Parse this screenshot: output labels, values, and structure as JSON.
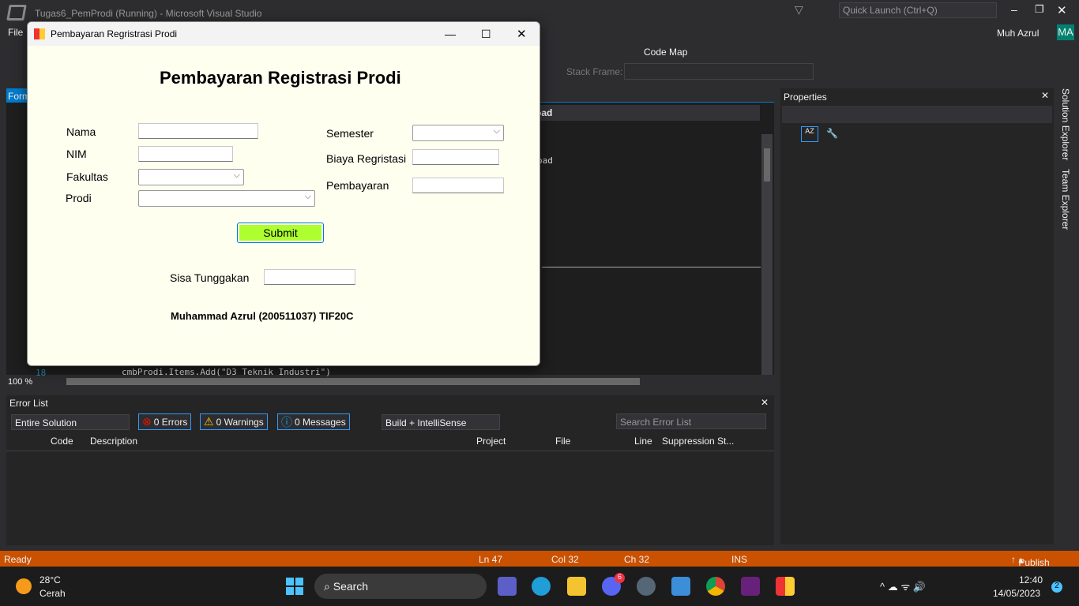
{
  "vs": {
    "title": "Tugas6_PemProdi (Running) - Microsoft Visual Studio",
    "menu_file": "File",
    "quick_launch": "Quick Launch (Ctrl+Q)",
    "user": "Muh Azrul",
    "user_initials": "MA",
    "code_map": "Code Map",
    "stack_frame": "Stack Frame:",
    "tab_form": "Form",
    "editor_dropdown": "oad",
    "code_fragment": "oad",
    "line_no": "18",
    "code_line": "cmbProdi.Items.Add(\"D3 Teknik Industri\")",
    "zoom": "100 %",
    "properties_title": "Properties",
    "solution_explorer": "Solution Explorer",
    "team_explorer": "Team Explorer"
  },
  "error_list": {
    "title": "Error List",
    "scope": "Entire Solution",
    "errors": "0 Errors",
    "warnings": "0 Warnings",
    "messages": "0 Messages",
    "build": "Build + IntelliSense",
    "search_placeholder": "Search Error List",
    "columns": [
      "Code",
      "Description",
      "Project",
      "File",
      "Line",
      "Suppression St..."
    ]
  },
  "status": {
    "ready": "Ready",
    "ln": "Ln 47",
    "col": "Col 32",
    "ch": "Ch 32",
    "ins": "INS",
    "publish": "Publish"
  },
  "form": {
    "window_title": "Pembayaran Regristrasi Prodi",
    "heading": "Pembayaran Registrasi Prodi",
    "labels": {
      "nama": "Nama",
      "nim": "NIM",
      "fakultas": "Fakultas",
      "prodi": "Prodi",
      "semester": "Semester",
      "biaya": "Biaya Regristasi",
      "pembayaran": "Pembayaran",
      "sisa": "Sisa Tunggakan"
    },
    "submit": "Submit",
    "credit": "Muhammad Azrul (200511037) TIF20C"
  },
  "taskbar": {
    "temp": "28°C",
    "weather": "Cerah",
    "search": "Search",
    "time": "12:40",
    "date": "14/05/2023",
    "discord_badge": "6",
    "notif": "2"
  }
}
